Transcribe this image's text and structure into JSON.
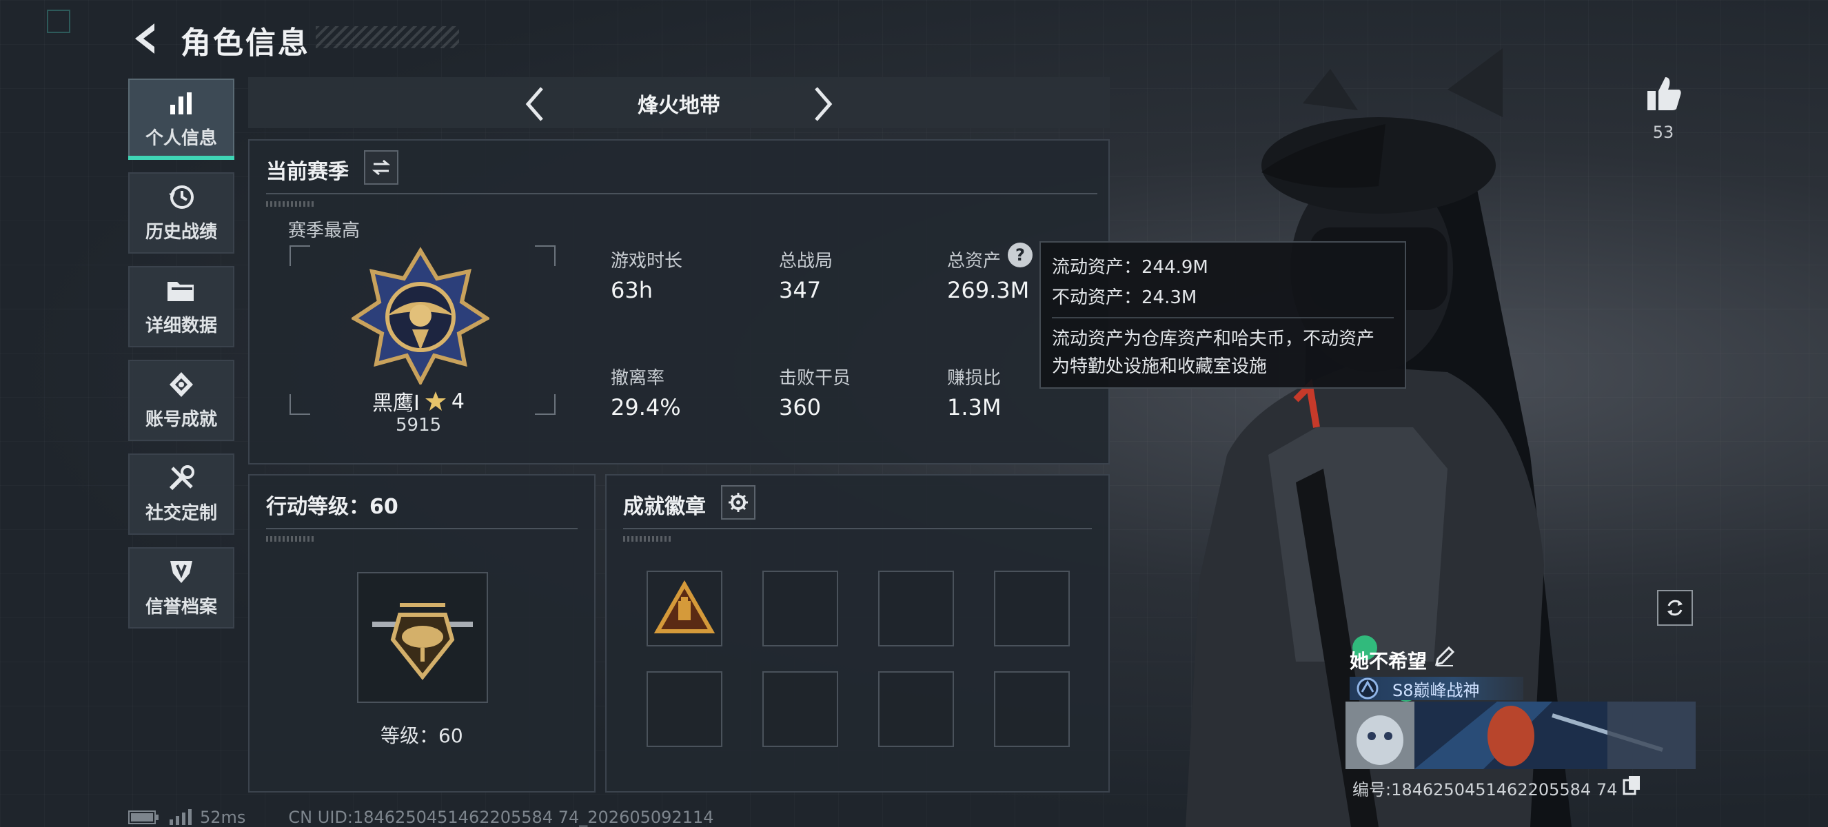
{
  "header": {
    "title": "角色信息"
  },
  "sidebar": {
    "items": [
      {
        "label": "个人信息",
        "icon": "bar-chart-icon",
        "active": true
      },
      {
        "label": "历史战绩",
        "icon": "history-clock-icon",
        "active": false
      },
      {
        "label": "详细数据",
        "icon": "folder-icon",
        "active": false
      },
      {
        "label": "账号成就",
        "icon": "achievement-diamond-icon",
        "active": false
      },
      {
        "label": "社交定制",
        "icon": "tools-icon",
        "active": false
      },
      {
        "label": "信誉档案",
        "icon": "shield-emblem-icon",
        "active": false
      }
    ]
  },
  "mode": {
    "name": "烽火地带"
  },
  "season": {
    "title": "当前赛季",
    "best_label": "赛季最高",
    "rank_name": "黑鹰I",
    "rank_stars": "4",
    "rank_score": "5915",
    "stats": [
      {
        "label": "游戏时长",
        "value": "63h"
      },
      {
        "label": "总战局",
        "value": "347"
      },
      {
        "label": "总资产",
        "value": "269.3M"
      },
      {
        "label": "撤离率",
        "value": "29.4%"
      },
      {
        "label": "击败干员",
        "value": "360"
      },
      {
        "label": "赚损比",
        "value": "1.3M"
      }
    ]
  },
  "tooltip": {
    "liquid": "流动资产：244.9M",
    "fixed": "不动资产：24.3M",
    "desc_line1": "流动资产为仓库资产和哈夫币，不动资产",
    "desc_line2": "为特勤处设施和收藏室设施"
  },
  "action_level": {
    "title": "行动等级：60",
    "level_text": "等级：60"
  },
  "achievements": {
    "title": "成就徽章",
    "filled_slots": 1,
    "total_slots": 8
  },
  "profile": {
    "likes": "53",
    "player_name": "她不希望",
    "title_badge": "S8巅峰战神",
    "uid_line": "编号:1846250451462205584 74"
  },
  "status": {
    "ping": "52ms",
    "uid_text": "CN UID:1846250451462205584 74_202605092114"
  },
  "colors": {
    "accent": "#3fd6b6",
    "panel": "#222830",
    "text": "#e6e9ec"
  }
}
